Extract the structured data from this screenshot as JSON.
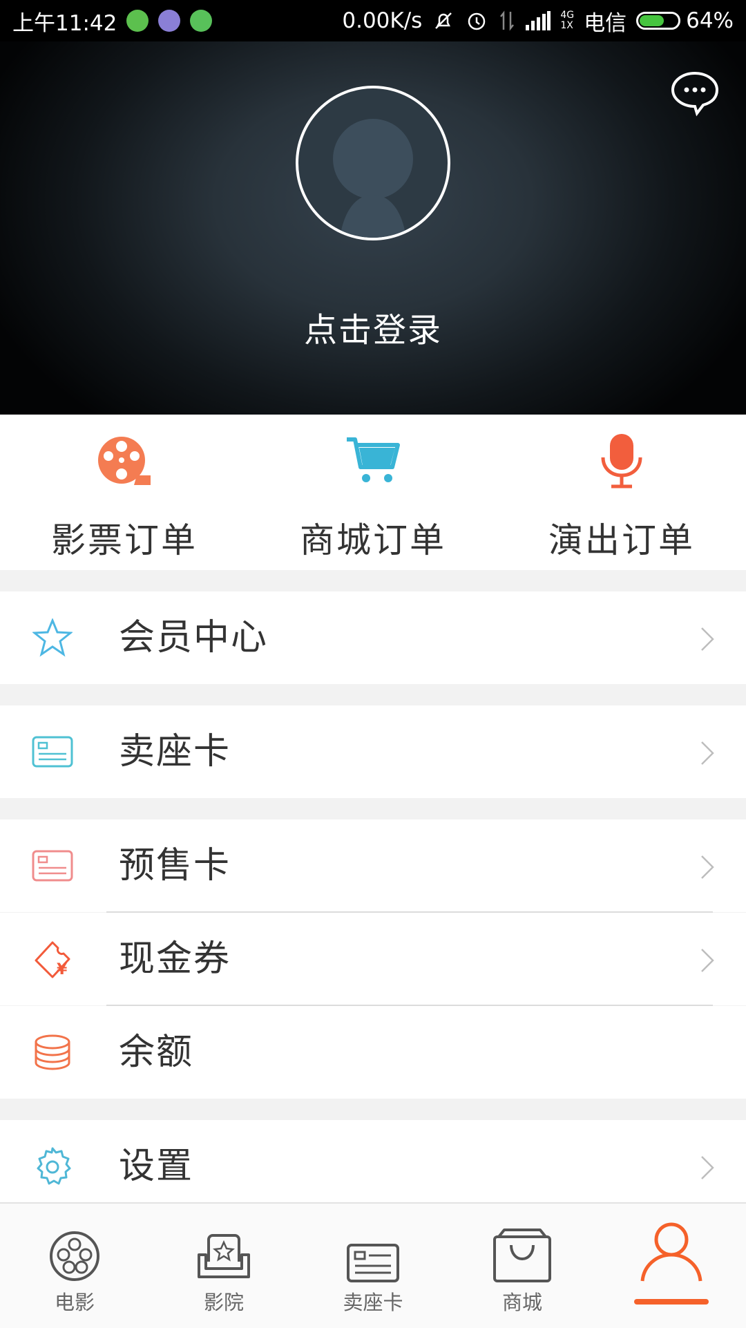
{
  "status_bar": {
    "time": "上午11:42",
    "net_speed": "0.00K/s",
    "network_type_top": "4G",
    "network_type_bottom": "1X",
    "carrier": "电信",
    "battery_percent": "64%",
    "battery_level": 0.64,
    "app_icon_colors": [
      "#5cc04e",
      "#8a7fd6",
      "#58c15a"
    ]
  },
  "profile": {
    "login_text": "点击登录",
    "message_icon": "chat-bubble-icon",
    "avatar_icon": "person-silhouette-icon"
  },
  "orders": [
    {
      "label": "影票订单",
      "icon": "film-reel-icon",
      "color": "#f47c52"
    },
    {
      "label": "商城订单",
      "icon": "shopping-cart-icon",
      "color": "#39b4d6"
    },
    {
      "label": "演出订单",
      "icon": "microphone-icon",
      "color": "#f25e3d"
    }
  ],
  "menu": [
    {
      "label": "会员中心",
      "icon": "star-icon",
      "color": "#4db7e3",
      "chevron": true
    },
    {
      "label": "卖座卡",
      "icon": "card-icon",
      "color": "#4fc1d3",
      "chevron": true
    },
    {
      "label": "预售卡",
      "icon": "card-icon",
      "color": "#f08c8c",
      "chevron": true
    },
    {
      "label": "现金券",
      "icon": "coupon-yen-icon",
      "color": "#f25a3a",
      "chevron": true
    },
    {
      "label": "余额",
      "icon": "coin-stack-icon",
      "color": "#f2734a",
      "chevron": false
    },
    {
      "label": "设置",
      "icon": "gear-icon",
      "color": "#4fb7d6",
      "chevron": true
    }
  ],
  "tabbar": [
    {
      "label": "电影",
      "icon": "film-reel-icon",
      "active": false
    },
    {
      "label": "影院",
      "icon": "seat-star-icon",
      "active": false
    },
    {
      "label": "卖座卡",
      "icon": "card-icon",
      "active": false
    },
    {
      "label": "商城",
      "icon": "shopping-bag-icon",
      "active": false
    },
    {
      "label": "",
      "icon": "person-icon",
      "active": true
    }
  ],
  "accent_color": "#f5612a"
}
